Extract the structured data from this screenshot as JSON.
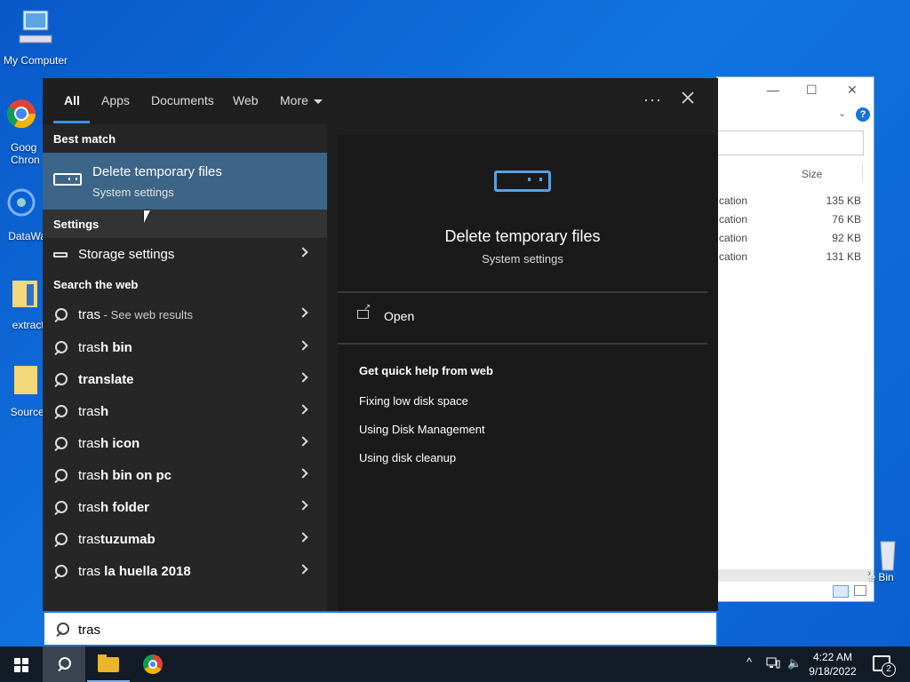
{
  "desktop": {
    "icons": [
      {
        "label": "My Computer",
        "icon": "computer-icon"
      },
      {
        "label": "Goog Chron",
        "icon": "chrome-icon"
      },
      {
        "label": "DataWag",
        "icon": "app-icon"
      },
      {
        "label": "extracte",
        "icon": "folder-icon"
      },
      {
        "label": "Source_",
        "icon": "folder-icon"
      },
      {
        "label": "e Bin",
        "icon": "recycle-bin-icon"
      }
    ]
  },
  "explorer": {
    "size_header": "Size",
    "rows": [
      {
        "type": "cation",
        "size": "135 KB"
      },
      {
        "type": "cation",
        "size": "76 KB"
      },
      {
        "type": "cation",
        "size": "92 KB"
      },
      {
        "type": "cation",
        "size": "131 KB"
      }
    ]
  },
  "search": {
    "tabs": {
      "all": "All",
      "apps": "Apps",
      "documents": "Documents",
      "web": "Web",
      "more": "More"
    },
    "options_label": "···",
    "best_match_header": "Best match",
    "best_match": {
      "title": "Delete temporary files",
      "subtitle": "System settings"
    },
    "settings_header": "Settings",
    "settings_items": [
      {
        "label": "Storage settings"
      }
    ],
    "web_header": "Search the web",
    "web_first": {
      "typed": "tras",
      "suffix": " - See web results"
    },
    "web_suggestions": [
      {
        "prefix": "tras",
        "rest": "h bin"
      },
      {
        "prefix": "",
        "rest": "translate"
      },
      {
        "prefix": "tras",
        "rest": "h"
      },
      {
        "prefix": "tras",
        "rest": "h icon"
      },
      {
        "prefix": "tras",
        "rest": "h bin on pc"
      },
      {
        "prefix": "tras",
        "rest": "h folder"
      },
      {
        "prefix": "tras",
        "rest": "tuzumab"
      },
      {
        "prefix": "tras",
        "rest": " la huella 2018"
      }
    ],
    "preview": {
      "title": "Delete temporary files",
      "subtitle": "System settings",
      "open_label": "Open",
      "help_header": "Get quick help from web",
      "help_links": [
        "Fixing low disk space",
        "Using Disk Management",
        "Using disk cleanup"
      ]
    },
    "query": "tras"
  },
  "taskbar": {
    "time": "4:22 AM",
    "date": "9/18/2022",
    "notification_count": "2"
  },
  "colors": {
    "accent": "#3b8ee8",
    "selected": "#3c6587",
    "panel": "#1f1f1f"
  }
}
